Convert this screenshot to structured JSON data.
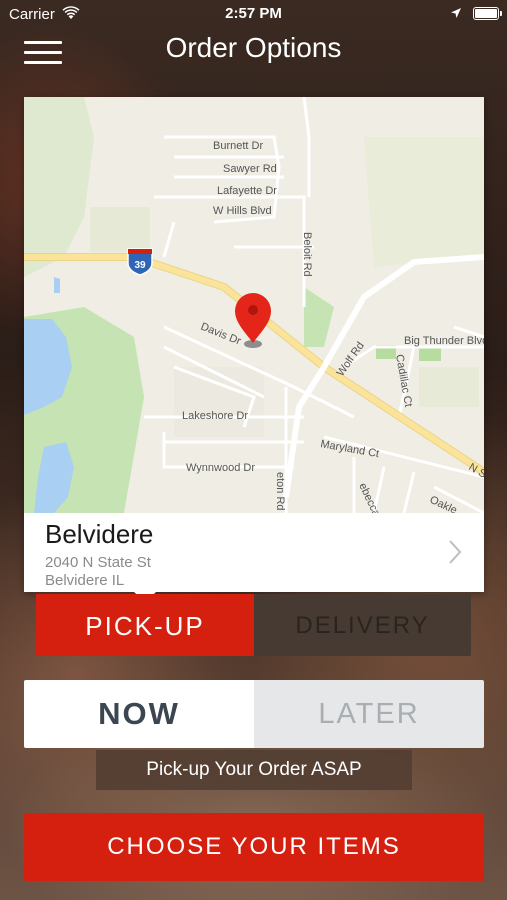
{
  "status_bar": {
    "carrier": "Carrier",
    "time": "2:57 PM"
  },
  "header": {
    "title": "Order Options",
    "menu_icon": "hamburger-menu-icon"
  },
  "map": {
    "highway_shield": "39",
    "streets": [
      "Burnett Dr",
      "Sawyer Rd",
      "Lafayette Dr",
      "W Hills Blvd",
      "Beloit Rd",
      "Davis Dr",
      "Big Thunder Blvd",
      "Wolf Rd",
      "Cadillac Ct",
      "Lakeshore Dr",
      "Maryland Ct",
      "Wynnwood Dr",
      "eton Rd",
      "ebecca Rd",
      "Oakle",
      "N S"
    ],
    "colors": {
      "land": "#f0ede4",
      "water": "#a9d0f2",
      "park": "#c6e3b4",
      "major_road": "#fbe49a",
      "pin": "#e4261a"
    }
  },
  "location": {
    "name": "Belvidere",
    "address": "2040 N State St",
    "city": "Belvidere IL"
  },
  "order_type": {
    "pickup_label": "PICK-UP",
    "delivery_label": "DELIVERY",
    "selected": "PICK-UP"
  },
  "timing": {
    "now_label": "NOW",
    "later_label": "LATER",
    "selected": "NOW",
    "note": "Pick-up Your Order ASAP"
  },
  "cta": {
    "label": "CHOOSE YOUR ITEMS"
  },
  "accent": "#d6200f"
}
